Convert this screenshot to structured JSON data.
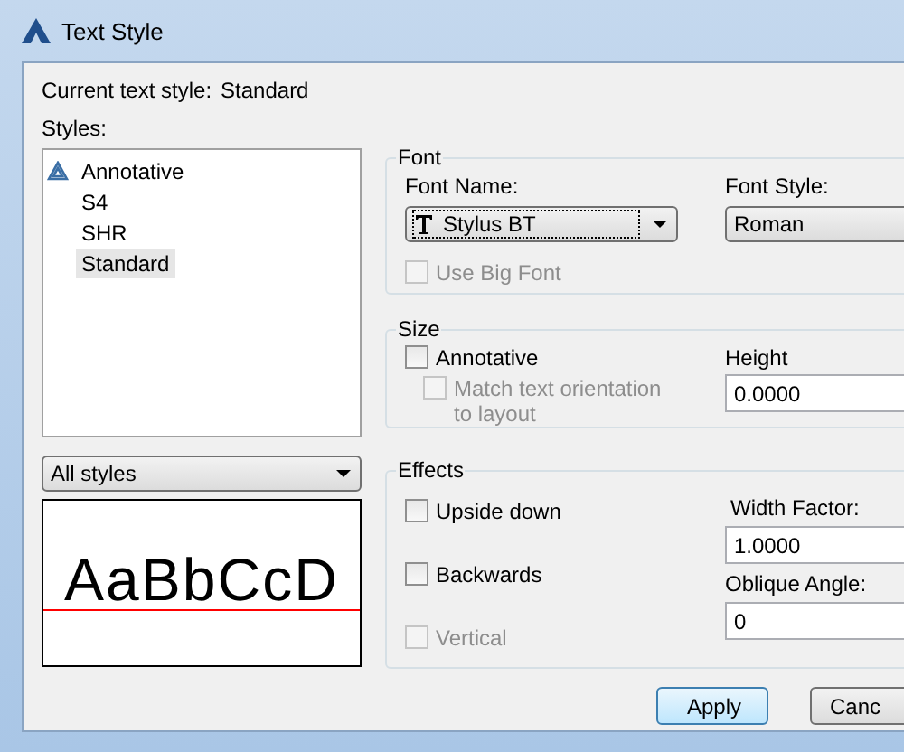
{
  "window": {
    "title": "Text Style"
  },
  "current_style": {
    "label": "Current text style:",
    "value": "Standard"
  },
  "styles": {
    "label": "Styles:",
    "items": [
      {
        "name": "Annotative",
        "annotative": true,
        "selected": false
      },
      {
        "name": "S4",
        "annotative": false,
        "selected": false
      },
      {
        "name": "SHR",
        "annotative": false,
        "selected": false
      },
      {
        "name": "Standard",
        "annotative": false,
        "selected": true
      }
    ]
  },
  "filter": {
    "value": "All styles"
  },
  "preview": {
    "sample": "AaBbCcD"
  },
  "font": {
    "title": "Font",
    "font_name": {
      "label": "Font Name:",
      "value": "Stylus BT"
    },
    "font_style": {
      "label": "Font Style:",
      "value": "Roman"
    },
    "use_big_font": {
      "label": "Use Big Font",
      "checked": false,
      "disabled": true
    }
  },
  "size": {
    "title": "Size",
    "annotative": {
      "label": "Annotative",
      "checked": false,
      "disabled": false
    },
    "match_orientation": {
      "label": "Match text orientation to layout",
      "checked": false,
      "disabled": true
    },
    "height": {
      "label": "Height",
      "value": "0.0000"
    }
  },
  "effects": {
    "title": "Effects",
    "checkboxes": [
      {
        "label": "Upside down",
        "checked": false,
        "disabled": false
      },
      {
        "label": "Backwards",
        "checked": false,
        "disabled": false
      },
      {
        "label": "Vertical",
        "checked": false,
        "disabled": true
      }
    ],
    "width_factor": {
      "label": "Width Factor:",
      "value": "1.0000"
    },
    "oblique_angle": {
      "label": "Oblique Angle:",
      "value": "0"
    }
  },
  "buttons": [
    {
      "label": "Apply",
      "focused": true
    },
    {
      "label": "Canc",
      "focused": false
    }
  ]
}
